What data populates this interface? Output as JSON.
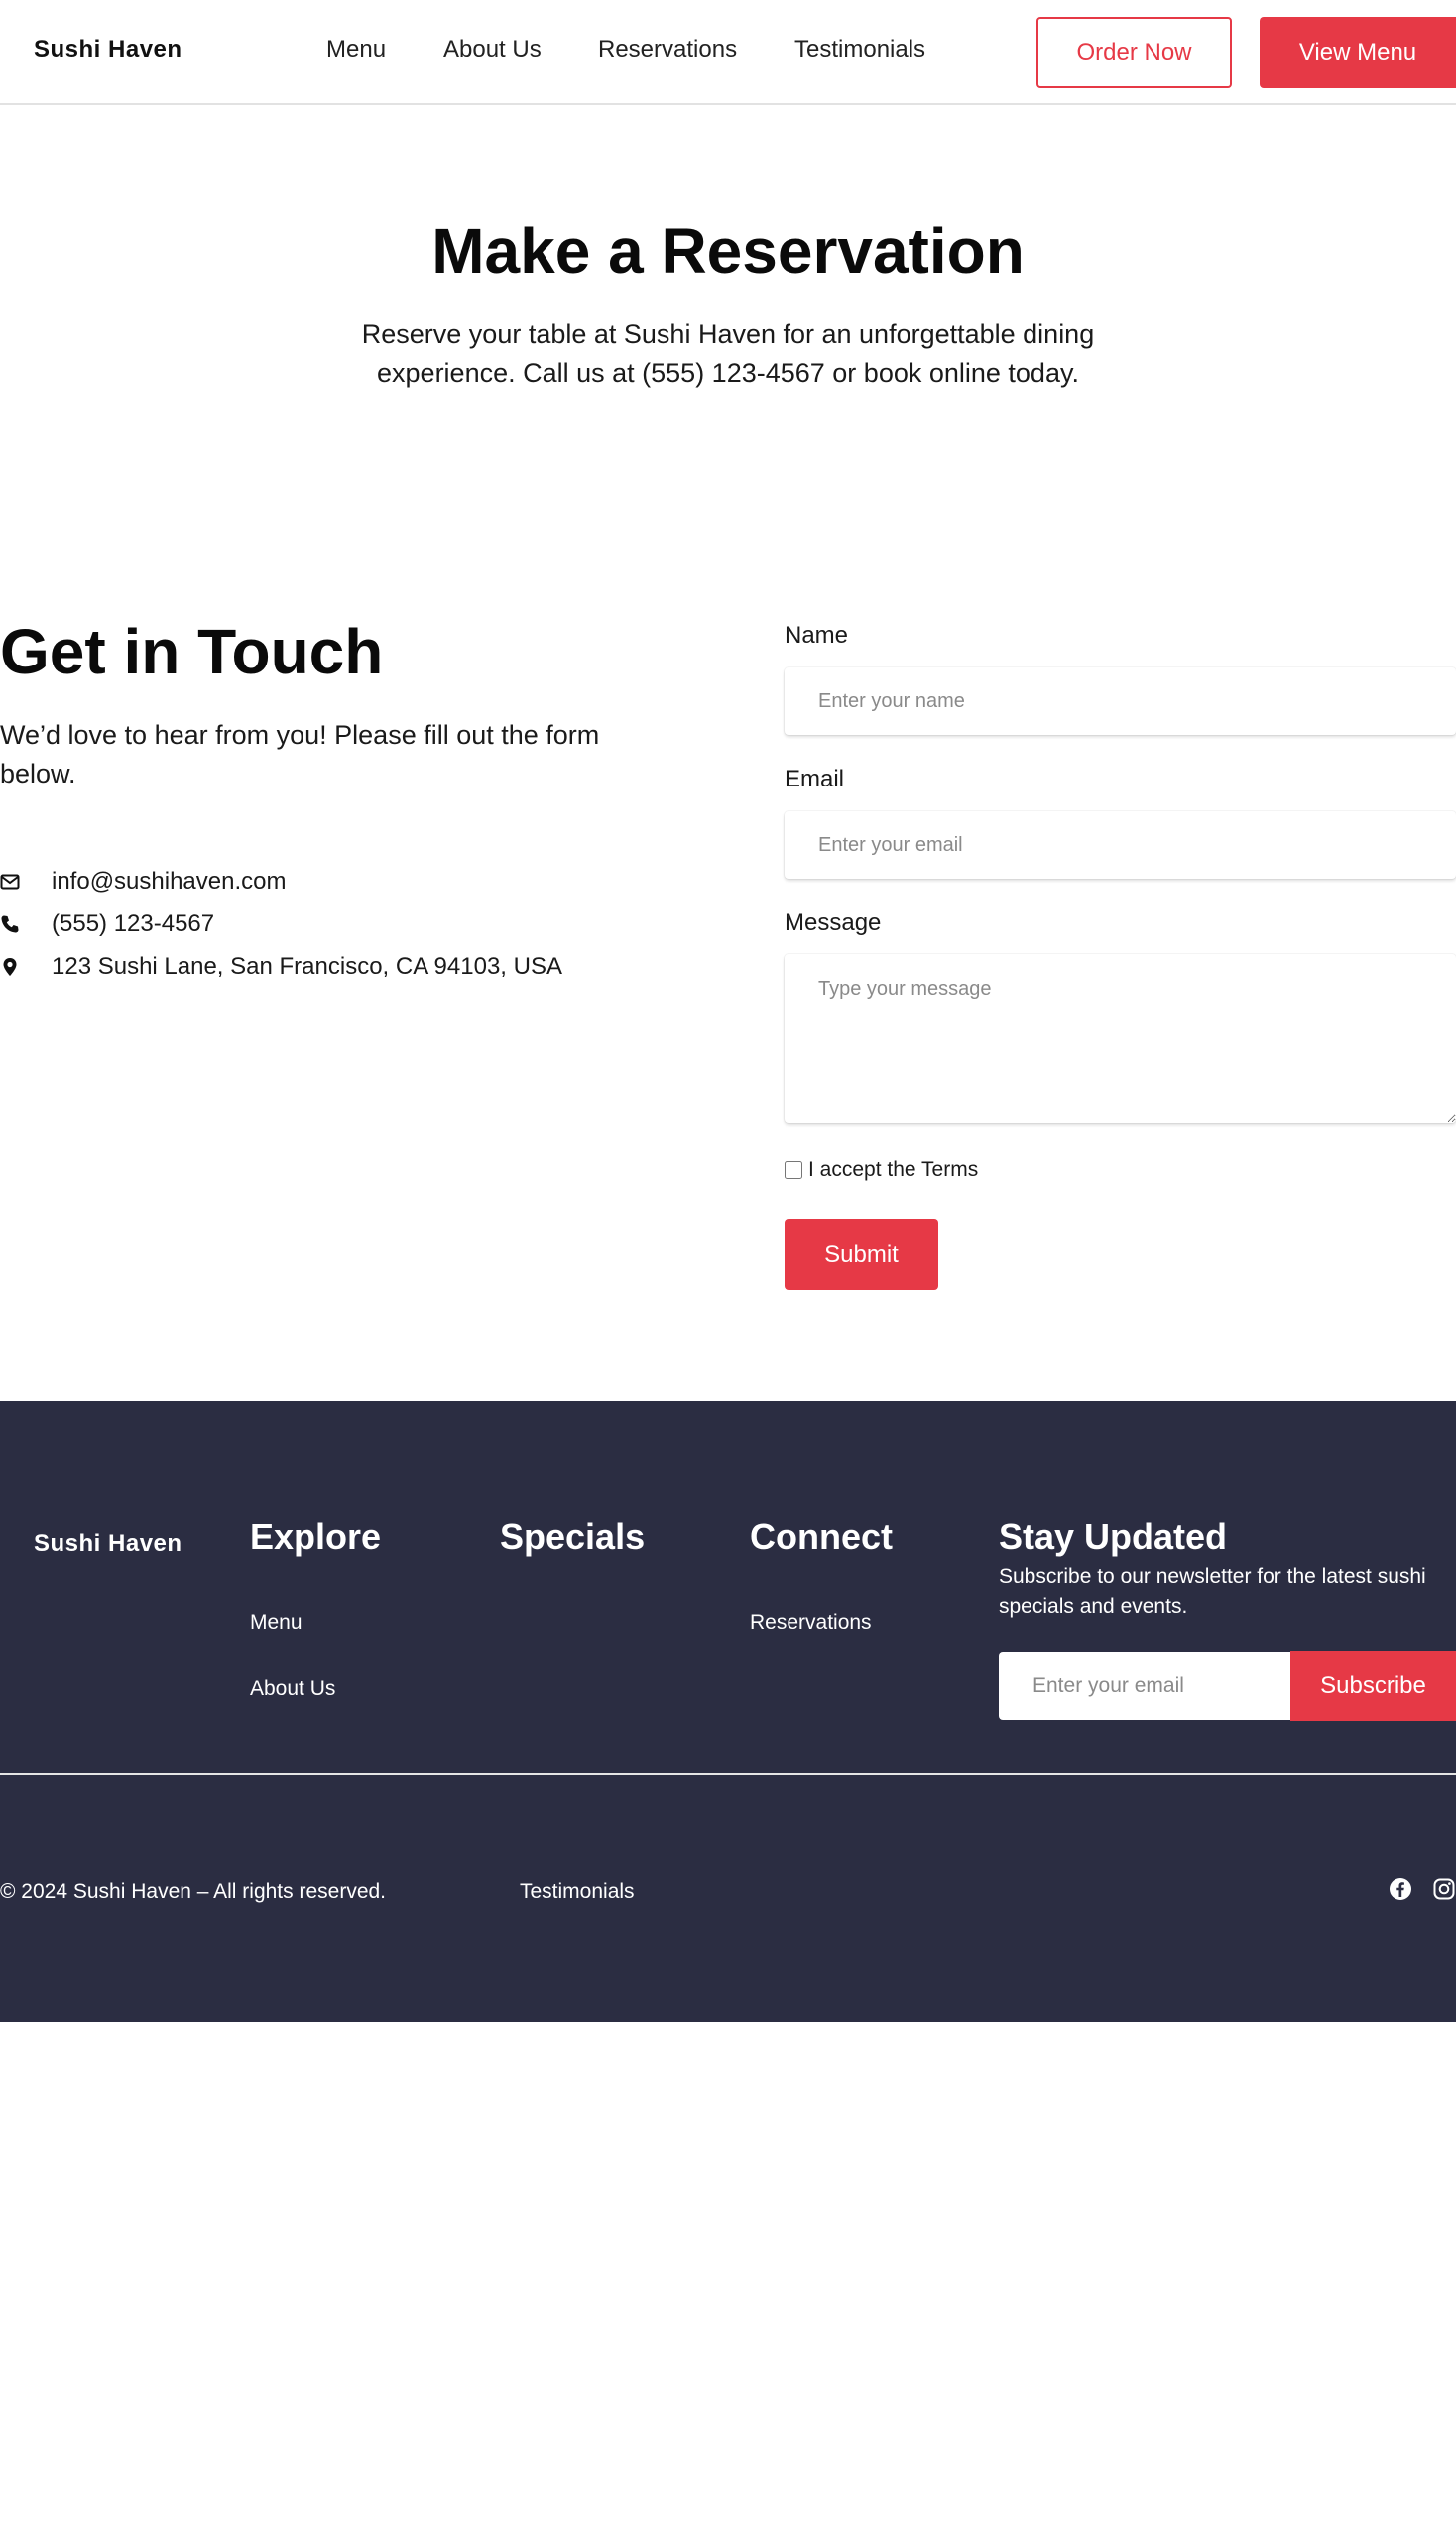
{
  "header": {
    "logo": "Sushi Haven",
    "nav": [
      "Menu",
      "About Us",
      "Reservations",
      "Testimonials"
    ],
    "order_now": "Order Now",
    "view_menu": "View Menu"
  },
  "hero": {
    "title": "Make a Reservation",
    "subtitle": "Reserve your table at Sushi Haven for an unforgettable dining experience. Call us at (555) 123-4567 or book online today."
  },
  "contact": {
    "title": "Get in Touch",
    "subtitle": "We’d love to hear from you! Please fill out the form below.",
    "email": "info@sushihaven.com",
    "phone": "(555) 123-4567",
    "address": "123 Sushi Lane, San Francisco, CA 94103, USA"
  },
  "form": {
    "name_label": "Name",
    "name_placeholder": "Enter your name",
    "email_label": "Email",
    "email_placeholder": "Enter your email",
    "message_label": "Message",
    "message_placeholder": "Type your message",
    "terms_label": "I accept the Terms",
    "submit": "Submit"
  },
  "footer": {
    "logo": "Sushi Haven",
    "explore": {
      "title": "Explore",
      "links": [
        "Menu",
        "About Us"
      ]
    },
    "specials": {
      "title": "Specials"
    },
    "connect": {
      "title": "Connect",
      "links": [
        "Reservations"
      ]
    },
    "stay_updated": {
      "title": "Stay Updated",
      "description": "Subscribe to our newsletter for the latest sushi specials and events.",
      "email_placeholder": "Enter your email",
      "subscribe": "Subscribe"
    },
    "copyright": "© 2024 Sushi Haven – All rights reserved.",
    "bottom_link": "Testimonials",
    "social_icons": [
      "facebook-icon",
      "instagram-icon"
    ]
  },
  "colors": {
    "accent": "#e63946",
    "footer_bg": "#2b2d42",
    "text": "#111111"
  }
}
